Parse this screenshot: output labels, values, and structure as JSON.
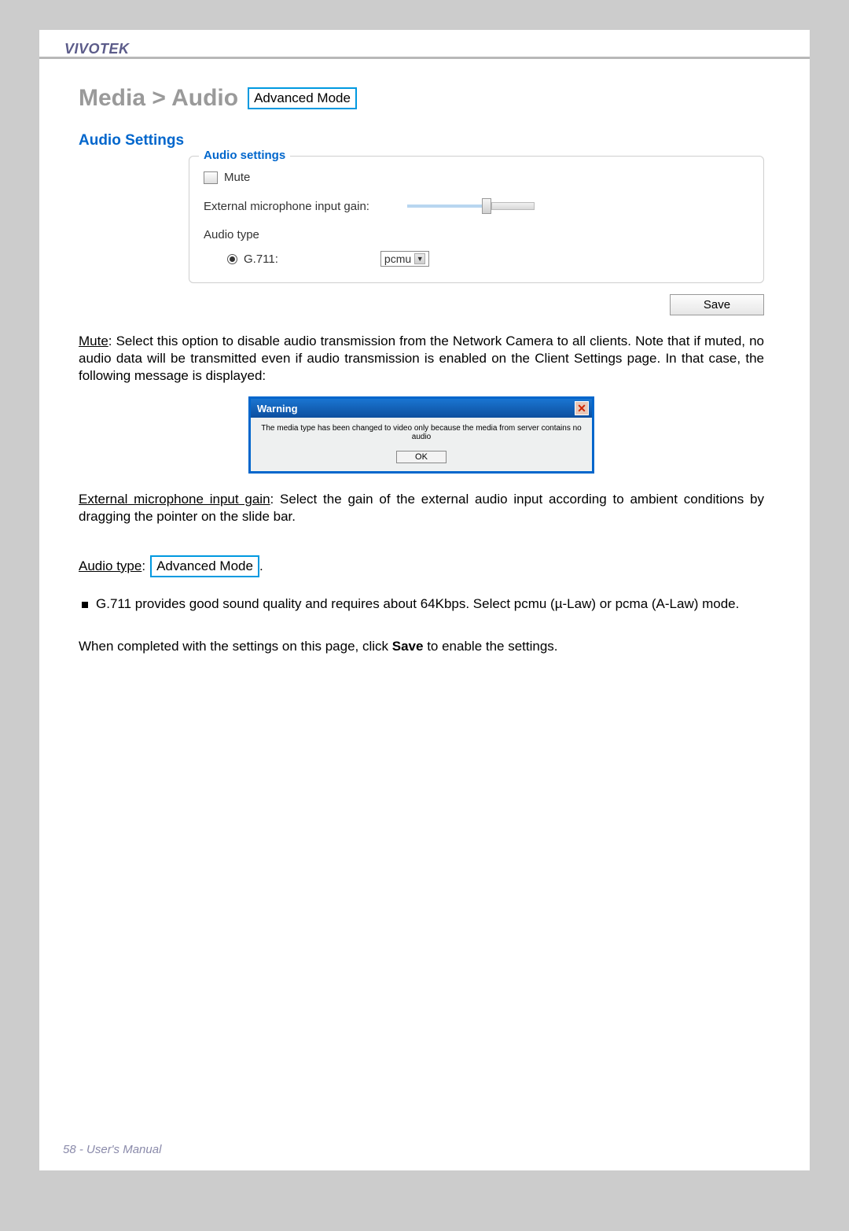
{
  "brand": "VIVOTEK",
  "breadcrumb": "Media > Audio",
  "adv_mode": "Advanced Mode",
  "section_title": "Audio Settings",
  "fieldset": {
    "legend": "Audio settings",
    "mute_label": "Mute",
    "gain_label": "External microphone input gain:",
    "audio_type_label": "Audio type",
    "codec_label": "G.711:",
    "codec_select": "pcmu"
  },
  "save_label": "Save",
  "para_mute_prefix": "Mute",
  "para_mute_body": ": Select this option to disable audio transmission from the Network Camera to all clients. Note that if muted, no audio data will be transmitted even if audio transmission is enabled on the Client Settings page. In that case, the following message is displayed:",
  "dialog": {
    "title": "Warning",
    "message": "The media type has been changed to video only because the media from server contains no audio",
    "ok": "OK"
  },
  "para_gain_prefix": "External microphone input gain",
  "para_gain_body": ": Select the gain of the external audio input according to ambient conditions by dragging the pointer on the slide bar.",
  "audio_type_prefix": "Audio type",
  "bullet_g711": "G.711 provides good sound quality and requires about 64Kbps. Select pcmu (µ-Law) or pcma (A-Law) mode.",
  "completion_pre": "When completed with the settings on this page, click ",
  "completion_bold": "Save",
  "completion_post": " to enable the settings.",
  "footer": "58 - User's Manual"
}
